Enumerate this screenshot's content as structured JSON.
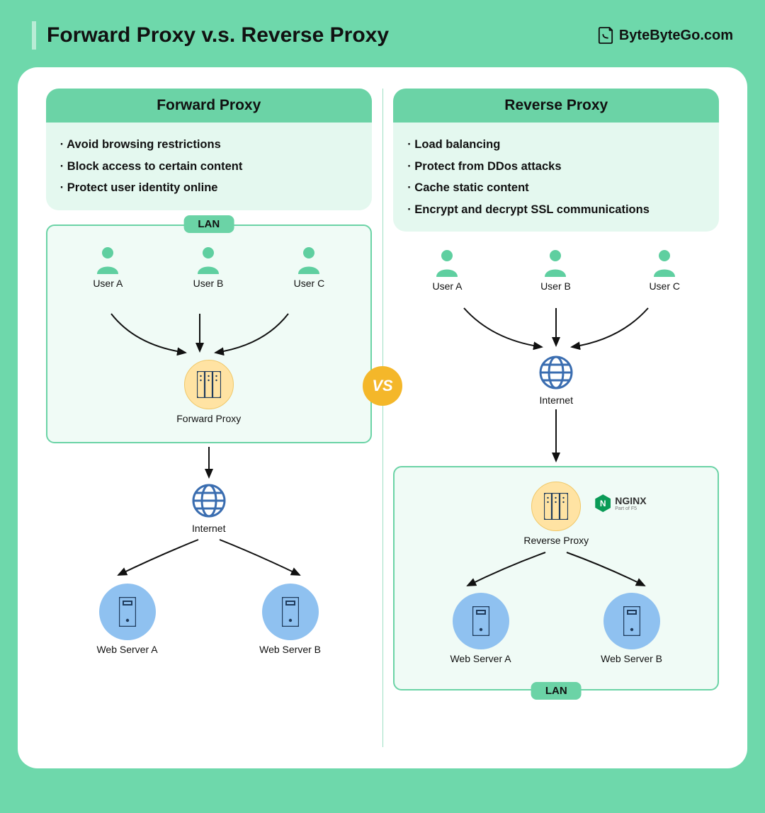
{
  "title": "Forward Proxy v.s. Reverse Proxy",
  "brand": "ByteByteGo.com",
  "vs": "VS",
  "forward": {
    "heading": "Forward Proxy",
    "bullets": [
      "Avoid browsing restrictions",
      "Block access to certain content",
      "Protect user identity online"
    ],
    "lan_label": "LAN",
    "users": [
      "User A",
      "User B",
      "User C"
    ],
    "proxy_label": "Forward Proxy",
    "internet_label": "Internet",
    "servers": [
      "Web Server A",
      "Web Server B"
    ]
  },
  "reverse": {
    "heading": "Reverse Proxy",
    "bullets": [
      "Load balancing",
      "Protect from DDos attacks",
      "Cache static content",
      "Encrypt and decrypt SSL communications"
    ],
    "users": [
      "User A",
      "User B",
      "User C"
    ],
    "internet_label": "Internet",
    "lan_label": "LAN",
    "proxy_label": "Reverse Proxy",
    "nginx": "NGINX",
    "nginx_sub": "Part of F5",
    "servers": [
      "Web Server A",
      "Web Server B"
    ]
  }
}
